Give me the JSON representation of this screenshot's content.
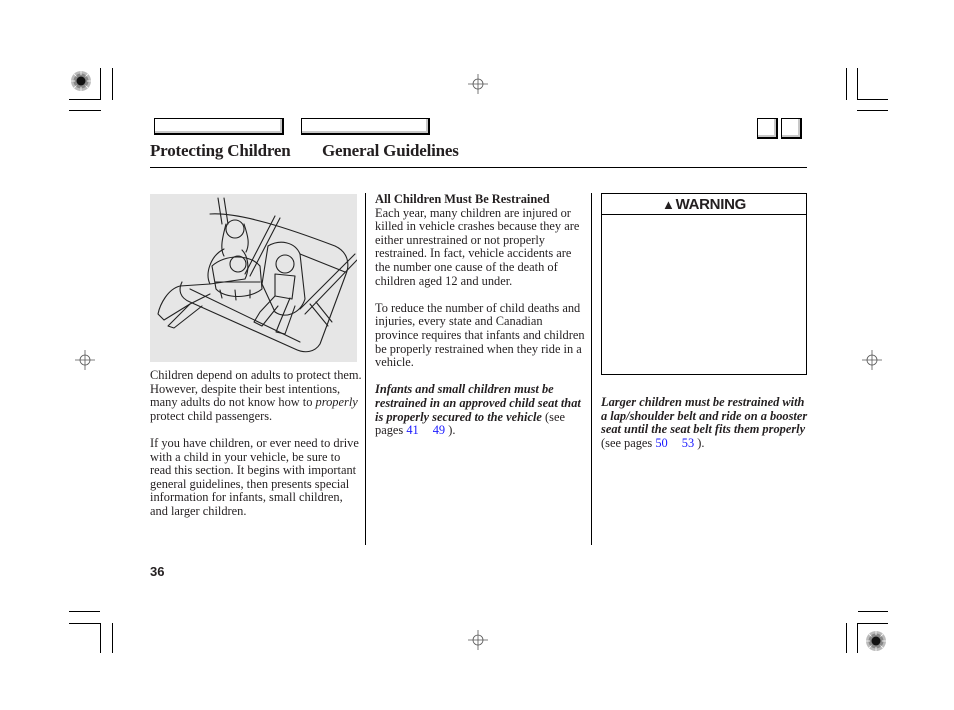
{
  "header": {
    "section": "Protecting Children",
    "subsection": "General Guidelines",
    "nav_buttons": [
      "",
      ""
    ],
    "corner_buttons": [
      "",
      ""
    ]
  },
  "figure": {
    "description": "Illustration of a woman seated in a vehicle rear seat beside an infant carrier and a child in a forward-facing child seat, with seat belts"
  },
  "column1": {
    "para1_before": "Children depend on adults to protect them. However, despite their best intentions, many adults do not know how to ",
    "para1_italic": "properly",
    "para1_after": " protect child passengers.",
    "para2": "If you have children, or ever need to drive with a child in your vehicle, be sure to read this section. It begins with important general guidelines, then presents special information for infants, small children, and larger children."
  },
  "column2": {
    "heading": "All Children Must Be Restrained",
    "para1": "Each year, many children are injured or killed in vehicle crashes because they are either unrestrained or not properly restrained. In fact, vehicle accidents are the number one cause of the death of children aged 12 and under.",
    "para2": "To reduce the number of child deaths and injuries, every state and Canadian province requires that infants and children be properly restrained when they ride in a vehicle.",
    "para3_bold_italic": "Infants and small children must be restrained in an approved child seat that is properly secured to the vehicle",
    "para3_see": " (see pages ",
    "para3_link1": "41",
    "para3_link2": "49",
    "para3_end": " )."
  },
  "column3": {
    "warning_label": "WARNING",
    "warning_icon": "warning-triangle-icon",
    "para_bold_italic": "Larger children must be restrained with a lap/shoulder belt and ride on a booster seat until the seat belt fits them properly",
    "para_see": " (see pages ",
    "para_link1": "50",
    "para_link2": "53",
    "para_end": " )."
  },
  "footer": {
    "page_number": "36"
  },
  "colors": {
    "link": "#1a1aff",
    "figure_bg": "#e6e6e6",
    "text": "#231f20"
  }
}
